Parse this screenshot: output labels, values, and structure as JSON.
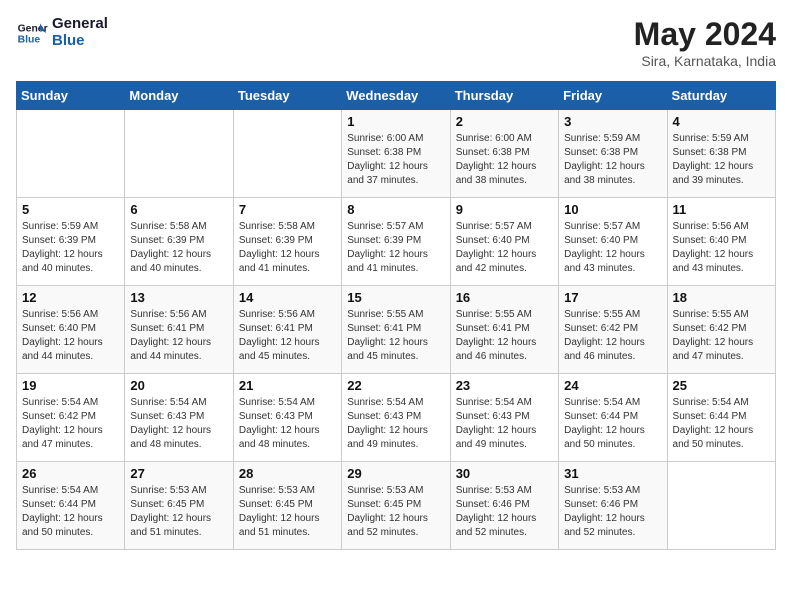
{
  "header": {
    "logo_line1": "General",
    "logo_line2": "Blue",
    "month": "May 2024",
    "location": "Sira, Karnataka, India"
  },
  "weekdays": [
    "Sunday",
    "Monday",
    "Tuesday",
    "Wednesday",
    "Thursday",
    "Friday",
    "Saturday"
  ],
  "weeks": [
    [
      {
        "day": "",
        "info": ""
      },
      {
        "day": "",
        "info": ""
      },
      {
        "day": "",
        "info": ""
      },
      {
        "day": "1",
        "info": "Sunrise: 6:00 AM\nSunset: 6:38 PM\nDaylight: 12 hours\nand 37 minutes."
      },
      {
        "day": "2",
        "info": "Sunrise: 6:00 AM\nSunset: 6:38 PM\nDaylight: 12 hours\nand 38 minutes."
      },
      {
        "day": "3",
        "info": "Sunrise: 5:59 AM\nSunset: 6:38 PM\nDaylight: 12 hours\nand 38 minutes."
      },
      {
        "day": "4",
        "info": "Sunrise: 5:59 AM\nSunset: 6:38 PM\nDaylight: 12 hours\nand 39 minutes."
      }
    ],
    [
      {
        "day": "5",
        "info": "Sunrise: 5:59 AM\nSunset: 6:39 PM\nDaylight: 12 hours\nand 40 minutes."
      },
      {
        "day": "6",
        "info": "Sunrise: 5:58 AM\nSunset: 6:39 PM\nDaylight: 12 hours\nand 40 minutes."
      },
      {
        "day": "7",
        "info": "Sunrise: 5:58 AM\nSunset: 6:39 PM\nDaylight: 12 hours\nand 41 minutes."
      },
      {
        "day": "8",
        "info": "Sunrise: 5:57 AM\nSunset: 6:39 PM\nDaylight: 12 hours\nand 41 minutes."
      },
      {
        "day": "9",
        "info": "Sunrise: 5:57 AM\nSunset: 6:40 PM\nDaylight: 12 hours\nand 42 minutes."
      },
      {
        "day": "10",
        "info": "Sunrise: 5:57 AM\nSunset: 6:40 PM\nDaylight: 12 hours\nand 43 minutes."
      },
      {
        "day": "11",
        "info": "Sunrise: 5:56 AM\nSunset: 6:40 PM\nDaylight: 12 hours\nand 43 minutes."
      }
    ],
    [
      {
        "day": "12",
        "info": "Sunrise: 5:56 AM\nSunset: 6:40 PM\nDaylight: 12 hours\nand 44 minutes."
      },
      {
        "day": "13",
        "info": "Sunrise: 5:56 AM\nSunset: 6:41 PM\nDaylight: 12 hours\nand 44 minutes."
      },
      {
        "day": "14",
        "info": "Sunrise: 5:56 AM\nSunset: 6:41 PM\nDaylight: 12 hours\nand 45 minutes."
      },
      {
        "day": "15",
        "info": "Sunrise: 5:55 AM\nSunset: 6:41 PM\nDaylight: 12 hours\nand 45 minutes."
      },
      {
        "day": "16",
        "info": "Sunrise: 5:55 AM\nSunset: 6:41 PM\nDaylight: 12 hours\nand 46 minutes."
      },
      {
        "day": "17",
        "info": "Sunrise: 5:55 AM\nSunset: 6:42 PM\nDaylight: 12 hours\nand 46 minutes."
      },
      {
        "day": "18",
        "info": "Sunrise: 5:55 AM\nSunset: 6:42 PM\nDaylight: 12 hours\nand 47 minutes."
      }
    ],
    [
      {
        "day": "19",
        "info": "Sunrise: 5:54 AM\nSunset: 6:42 PM\nDaylight: 12 hours\nand 47 minutes."
      },
      {
        "day": "20",
        "info": "Sunrise: 5:54 AM\nSunset: 6:43 PM\nDaylight: 12 hours\nand 48 minutes."
      },
      {
        "day": "21",
        "info": "Sunrise: 5:54 AM\nSunset: 6:43 PM\nDaylight: 12 hours\nand 48 minutes."
      },
      {
        "day": "22",
        "info": "Sunrise: 5:54 AM\nSunset: 6:43 PM\nDaylight: 12 hours\nand 49 minutes."
      },
      {
        "day": "23",
        "info": "Sunrise: 5:54 AM\nSunset: 6:43 PM\nDaylight: 12 hours\nand 49 minutes."
      },
      {
        "day": "24",
        "info": "Sunrise: 5:54 AM\nSunset: 6:44 PM\nDaylight: 12 hours\nand 50 minutes."
      },
      {
        "day": "25",
        "info": "Sunrise: 5:54 AM\nSunset: 6:44 PM\nDaylight: 12 hours\nand 50 minutes."
      }
    ],
    [
      {
        "day": "26",
        "info": "Sunrise: 5:54 AM\nSunset: 6:44 PM\nDaylight: 12 hours\nand 50 minutes."
      },
      {
        "day": "27",
        "info": "Sunrise: 5:53 AM\nSunset: 6:45 PM\nDaylight: 12 hours\nand 51 minutes."
      },
      {
        "day": "28",
        "info": "Sunrise: 5:53 AM\nSunset: 6:45 PM\nDaylight: 12 hours\nand 51 minutes."
      },
      {
        "day": "29",
        "info": "Sunrise: 5:53 AM\nSunset: 6:45 PM\nDaylight: 12 hours\nand 52 minutes."
      },
      {
        "day": "30",
        "info": "Sunrise: 5:53 AM\nSunset: 6:46 PM\nDaylight: 12 hours\nand 52 minutes."
      },
      {
        "day": "31",
        "info": "Sunrise: 5:53 AM\nSunset: 6:46 PM\nDaylight: 12 hours\nand 52 minutes."
      },
      {
        "day": "",
        "info": ""
      }
    ]
  ]
}
